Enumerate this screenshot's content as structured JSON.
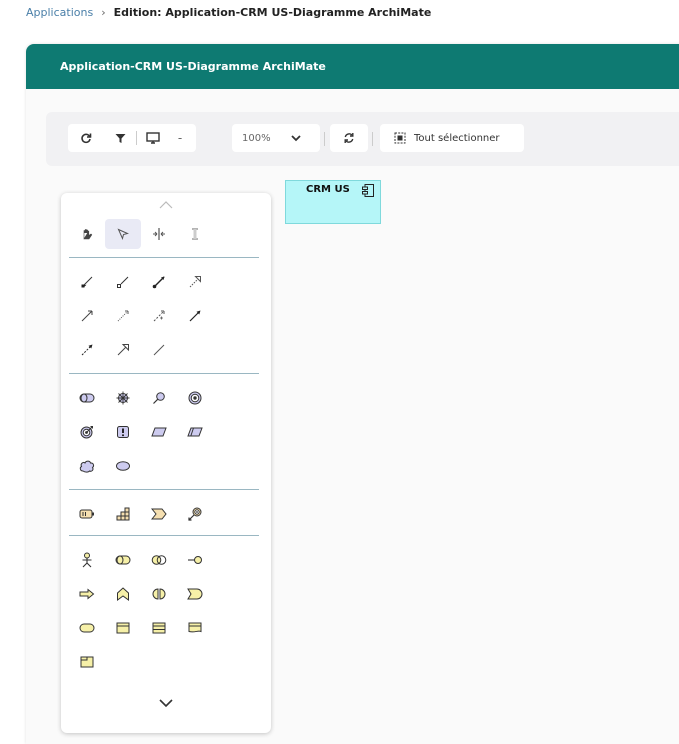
{
  "breadcrumb": {
    "root": "Applications",
    "separator": "›",
    "current": "Edition: Application-CRM US-Diagramme ArchiMate"
  },
  "header": {
    "title": "Application-CRM US-Diagramme ArchiMate"
  },
  "toolbar": {
    "refresh_icon": "refresh-icon",
    "filter_icon": "filter-icon",
    "display_icon": "monitor-icon",
    "display_dropdown": "-",
    "zoom": "100%",
    "sync_icon": "sync-icon",
    "select_all_label": "Tout sélectionner"
  },
  "canvas": {
    "node": {
      "label": "CRM US",
      "type_icon": "application-component-icon",
      "fill": "#b5f6f8"
    }
  },
  "palette": {
    "accent_active": "#e9eaf5",
    "element_fill": "#f6f0a8",
    "tools": [
      "hand-icon",
      "pointer-icon",
      "split-icon",
      "marquee-icon"
    ],
    "relations": [
      "composition-icon",
      "aggregation-icon",
      "assignment-icon",
      "realization-icon",
      "serving-icon",
      "access-icon",
      "influence-icon",
      "triggering-icon",
      "flow-icon",
      "specialization-icon",
      "association-icon"
    ],
    "motivation": [
      "stakeholder-icon",
      "driver-icon",
      "assessment-icon",
      "goal-icon",
      "outcome-icon",
      "principle-icon",
      "requirement-icon",
      "constraint-icon",
      "meaning-icon",
      "value-icon"
    ],
    "strategy": [
      "resource-icon",
      "capability-icon",
      "value-stream-icon",
      "course-of-action-icon"
    ],
    "business": [
      "business-actor-icon",
      "business-role-icon",
      "business-collaboration-icon",
      "business-interface-icon",
      "business-process-icon",
      "business-function-icon",
      "business-interaction-icon",
      "business-event-icon",
      "business-service-icon",
      "business-object-icon",
      "contract-icon",
      "representation-icon",
      "product-icon"
    ]
  }
}
